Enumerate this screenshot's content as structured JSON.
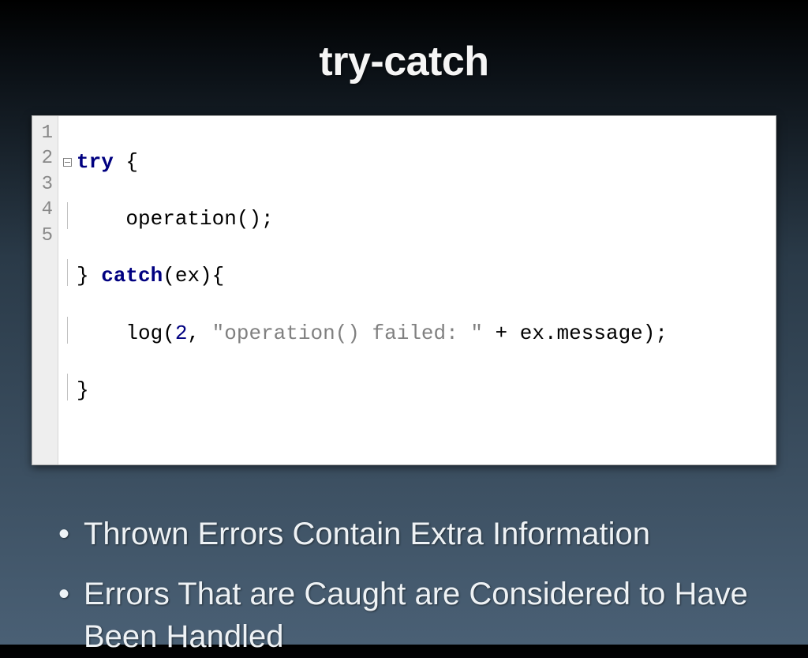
{
  "title": "try-catch",
  "code": {
    "line_numbers": [
      "1",
      "2",
      "3",
      "4",
      "5"
    ],
    "l1": {
      "try": "try",
      "brace": " {"
    },
    "l2": {
      "indent": "    ",
      "call": "operation();"
    },
    "l3": {
      "close": "} ",
      "catch": "catch",
      "cond": "(ex){"
    },
    "l4": {
      "indent": "    ",
      "fn": "log(",
      "num": "2",
      "sep": ", ",
      "str": "\"operation() failed: \"",
      "plus": " + ex.message);"
    },
    "l5": {
      "brace": "}"
    }
  },
  "bullets": [
    "Thrown Errors Contain Extra Information",
    "Errors That are Caught are Considered to Have Been Handled"
  ]
}
